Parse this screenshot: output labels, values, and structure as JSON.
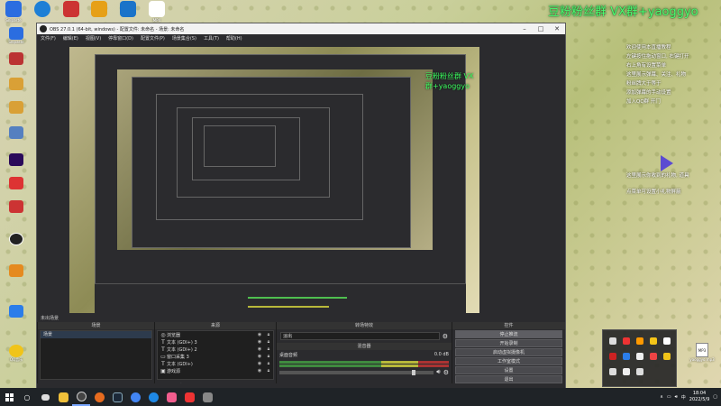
{
  "desktop": {
    "left_icons": [
      {
        "label": "Snipaste",
        "color": "#2b6de0"
      },
      {
        "label": "TeamViewer",
        "color": "#2a8cd8"
      },
      {
        "label": "",
        "color": "#b33"
      },
      {
        "label": "",
        "color": "#d9a036"
      },
      {
        "label": "",
        "color": "#d9a036"
      },
      {
        "label": "",
        "color": "#5580c0"
      },
      {
        "label": "Pr",
        "color": "#2a0a5a"
      },
      {
        "label": "Ps",
        "color": "#d32"
      },
      {
        "label": "",
        "color": "#c33"
      },
      {
        "label": "OBS",
        "color": "#222"
      },
      {
        "label": "",
        "color": "#e58a1f"
      },
      {
        "label": "",
        "color": "#2b7de9"
      },
      {
        "label": "QQ音乐",
        "color": "#f0c419"
      }
    ],
    "top_icons": [
      {
        "label": "",
        "color": "#1e7fd6"
      },
      {
        "label": "",
        "color": "#c33"
      },
      {
        "label": "",
        "color": "#e6a017"
      },
      {
        "label": "",
        "color": "#9c5"
      },
      {
        "label": "",
        "color": "#1a73c9"
      },
      {
        "label": "MP4",
        "color": "#ffffff"
      }
    ],
    "mp3_file": {
      "label": "MP3",
      "name": "yaoggyo.mp3"
    }
  },
  "obs": {
    "window_title": "OBS 27.0.1 (64-bit, windows) - 配置文件: 未命名 - 场景: 未命名",
    "menu": [
      "文件(F)",
      "编辑(E)",
      "视图(V)",
      "停靠窗口(D)",
      "配置文件(P)",
      "场景集合(S)",
      "工具(T)",
      "帮助(H)"
    ],
    "preview_overlay_lines": [
      "欢迎使用本直播教程",
      "左键按住拖动窗口",
      "右键打开设置菜单",
      "这里展示弹幕、关注、礼物",
      "粉丝牌大于等于",
      "添加弹幕的手动设置"
    ],
    "preview_watermark": "豆粉粉丝群 VX群+yaoggyo",
    "docks": {
      "scenes_header": "场景",
      "scenes": [
        "场景"
      ],
      "sources_header": "来源",
      "sources": [
        {
          "icon": "◎",
          "name": "浏览器"
        },
        {
          "icon": "T",
          "name": "文本 (GDI+) 3"
        },
        {
          "icon": "T",
          "name": "文本 (GDI+) 2"
        },
        {
          "icon": "▭",
          "name": "窗口采集 3"
        },
        {
          "icon": "T",
          "name": "文本 (GDI+)"
        },
        {
          "icon": "▣",
          "name": "游戏源"
        }
      ],
      "transitions_header": "转场特效",
      "transition_value": "淡出",
      "mixer_header": "混音器",
      "mixer_channel": "桌面音频",
      "mixer_db": "0.0 dB",
      "controls_header": "控件",
      "controls": [
        "停止推流",
        "开始录制",
        "启动虚拟摄像机",
        "工作室模式",
        "设置",
        "退出"
      ],
      "scene_filter_label": "未出场景",
      "source_filter_label": "来源"
    }
  },
  "overlay": {
    "watermark": "豆粉粉丝群 VX群+yaoggyo",
    "lines_top": [
      "欢迎使用本直播教程",
      "左键按住拖动窗口, 右键打开",
      "右上角有设置菜单",
      "这里展示弹幕、关注、礼物",
      "粉丝牌大于等于",
      "添加弹幕的手动设置",
      "加入QQ群  开门"
    ],
    "lines_bottom": [
      "这里展示你收到的礼物, 道具",
      "点菜单可设置小礼物屏蔽"
    ]
  },
  "taskbar": {
    "time": "18:04",
    "date": "2022/5/9",
    "apps": [
      {
        "name": "task-view",
        "color": "#ddd"
      },
      {
        "name": "explorer",
        "color": "#f0c03a"
      },
      {
        "name": "obs",
        "color": "#444"
      },
      {
        "name": "firefox",
        "color": "#e66b1f"
      },
      {
        "name": "steam",
        "color": "#1b2838"
      },
      {
        "name": "chrome",
        "color": "#4285f4"
      },
      {
        "name": "edge",
        "color": "#1e88e5"
      },
      {
        "name": "bilibili",
        "color": "#f25d8e"
      },
      {
        "name": "qq-video",
        "color": "#e33"
      },
      {
        "name": "other",
        "color": "#888"
      }
    ]
  }
}
